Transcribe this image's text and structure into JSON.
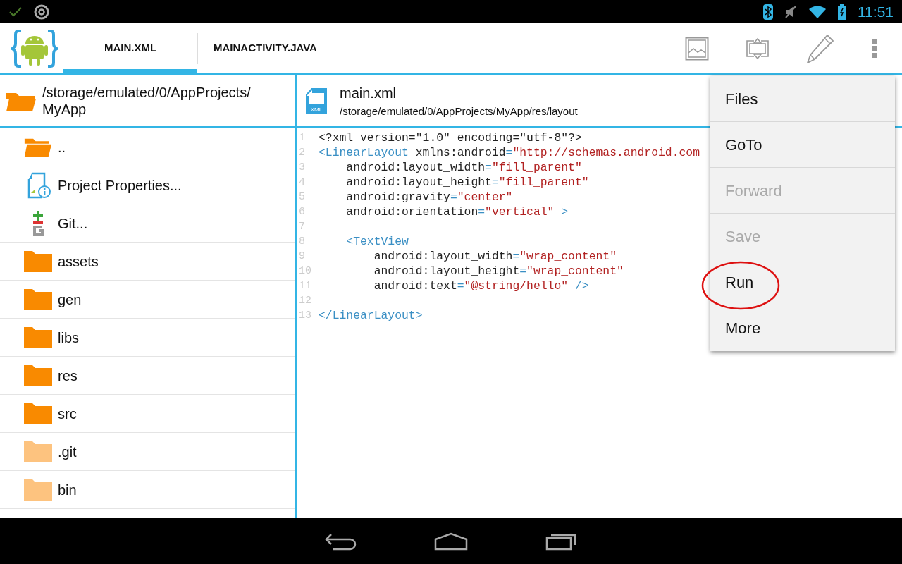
{
  "status_bar": {
    "time": "11:51"
  },
  "action_bar": {
    "tabs": [
      {
        "label": "MAIN.XML",
        "selected": true
      },
      {
        "label": "MAINACTIVITY.JAVA",
        "selected": false
      }
    ]
  },
  "file_browser": {
    "path_lines": [
      "/storage/emulated/0/AppProjects/",
      "MyApp"
    ],
    "items": [
      {
        "kind": "parent",
        "label": ".."
      },
      {
        "kind": "properties",
        "label": "Project Properties..."
      },
      {
        "kind": "git",
        "label": "Git..."
      },
      {
        "kind": "folder",
        "label": "assets"
      },
      {
        "kind": "folder",
        "label": "gen"
      },
      {
        "kind": "folder",
        "label": "libs"
      },
      {
        "kind": "folder",
        "label": "res"
      },
      {
        "kind": "folder",
        "label": "src"
      },
      {
        "kind": "hidden-folder",
        "label": ".git"
      },
      {
        "kind": "hidden-folder",
        "label": "bin"
      }
    ]
  },
  "editor": {
    "file_type_label": "XML",
    "file_name": "main.xml",
    "file_path": "/storage/emulated/0/AppProjects/MyApp/res/layout",
    "lines": [
      {
        "number": "1",
        "segments": [
          {
            "kind": "plain",
            "text": "<?xml version=\"1.0\" encoding=\"utf-8\"?>"
          }
        ]
      },
      {
        "number": "2",
        "segments": [
          {
            "kind": "tag",
            "text": "<LinearLayout"
          },
          {
            "kind": "plain",
            "text": " xmlns:android"
          },
          {
            "kind": "punct",
            "text": "="
          },
          {
            "kind": "value",
            "text": "\"http://schemas.android.com"
          }
        ]
      },
      {
        "number": "3",
        "segments": [
          {
            "kind": "plain",
            "text": "    android:layout_width"
          },
          {
            "kind": "punct",
            "text": "="
          },
          {
            "kind": "value",
            "text": "\"fill_parent\""
          }
        ]
      },
      {
        "number": "4",
        "segments": [
          {
            "kind": "plain",
            "text": "    android:layout_height"
          },
          {
            "kind": "punct",
            "text": "="
          },
          {
            "kind": "value",
            "text": "\"fill_parent\""
          }
        ]
      },
      {
        "number": "5",
        "segments": [
          {
            "kind": "plain",
            "text": "    android:gravity"
          },
          {
            "kind": "punct",
            "text": "="
          },
          {
            "kind": "value",
            "text": "\"center\""
          }
        ]
      },
      {
        "number": "6",
        "segments": [
          {
            "kind": "plain",
            "text": "    android:orientation"
          },
          {
            "kind": "punct",
            "text": "="
          },
          {
            "kind": "value",
            "text": "\"vertical\""
          },
          {
            "kind": "tag",
            "text": " >"
          }
        ]
      },
      {
        "number": "7"
      },
      {
        "number": "8",
        "segments": [
          {
            "kind": "tag",
            "text": "    <TextView"
          }
        ]
      },
      {
        "number": "9",
        "segments": [
          {
            "kind": "plain",
            "text": "        android:layout_width"
          },
          {
            "kind": "punct",
            "text": "="
          },
          {
            "kind": "value",
            "text": "\"wrap_content\""
          }
        ]
      },
      {
        "number": "10",
        "segments": [
          {
            "kind": "plain",
            "text": "        android:layout_height"
          },
          {
            "kind": "punct",
            "text": "="
          },
          {
            "kind": "value",
            "text": "\"wrap_content\""
          }
        ]
      },
      {
        "number": "11",
        "segments": [
          {
            "kind": "plain",
            "text": "        android:text"
          },
          {
            "kind": "punct",
            "text": "="
          },
          {
            "kind": "value",
            "text": "\"@string/hello\""
          },
          {
            "kind": "tag",
            "text": " />"
          }
        ]
      },
      {
        "number": "12"
      },
      {
        "number": "13",
        "segments": [
          {
            "kind": "tag",
            "text": "</LinearLayout>"
          }
        ]
      }
    ]
  },
  "menu": {
    "items": [
      {
        "label": "Files",
        "disabled": false,
        "circled": false
      },
      {
        "label": "GoTo",
        "disabled": false,
        "circled": false
      },
      {
        "label": "Forward",
        "disabled": true,
        "circled": false
      },
      {
        "label": "Save",
        "disabled": true,
        "circled": false
      },
      {
        "label": "Run",
        "disabled": false,
        "circled": true
      },
      {
        "label": "More",
        "disabled": false,
        "circled": false
      }
    ]
  }
}
